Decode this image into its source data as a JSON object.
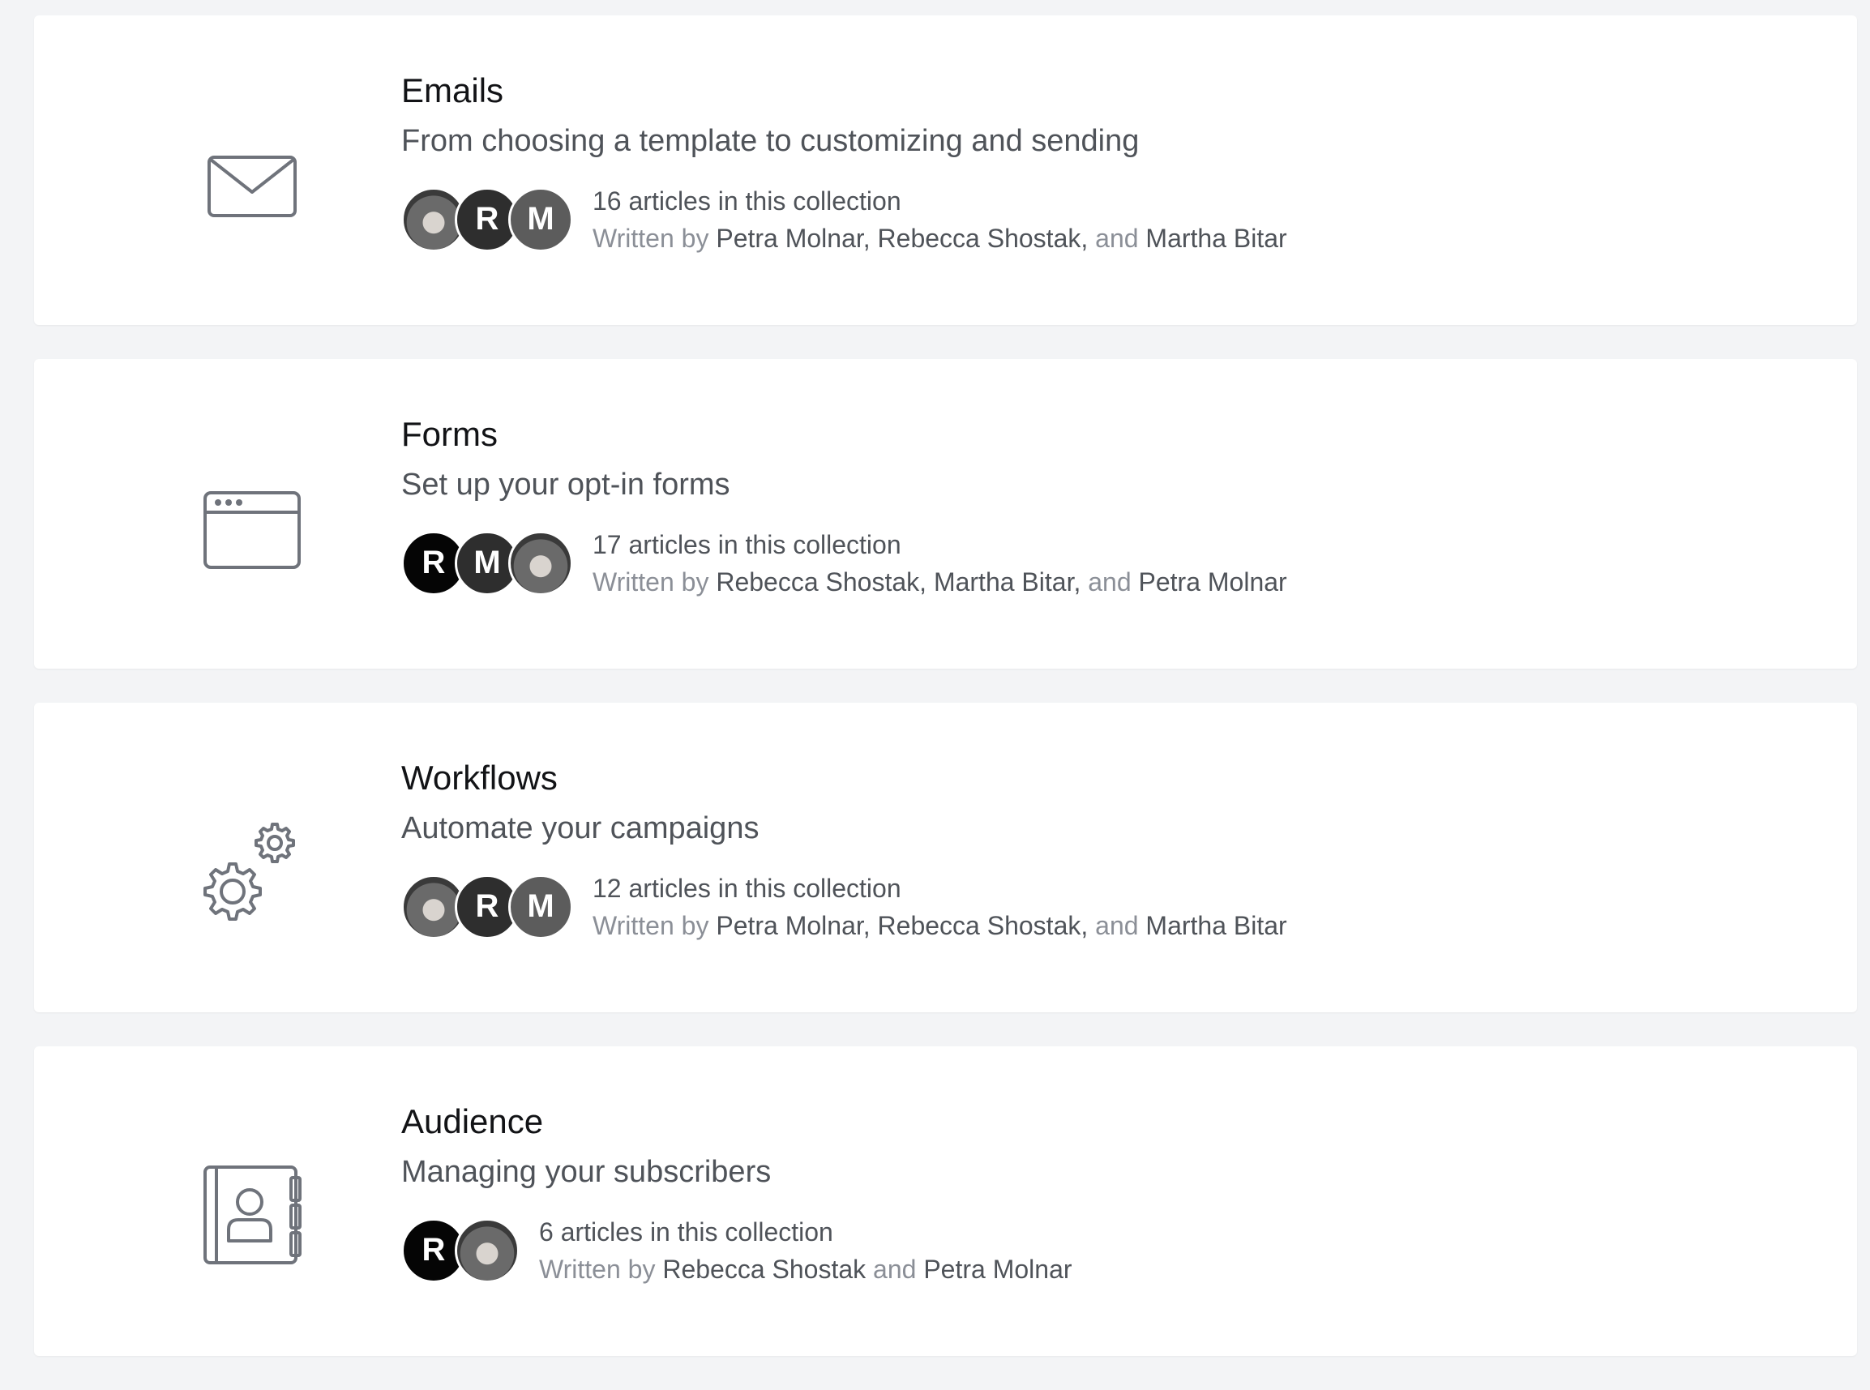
{
  "colors": {
    "page_background": "#f3f4f6",
    "card_background": "#ffffff",
    "icon_stroke": "#6f737b",
    "avatar_r_black": "#050505",
    "avatar_dark": "#2e2e2e",
    "avatar_mid": "#5c5c5c"
  },
  "collections": [
    {
      "title": "Emails",
      "description": "From choosing a template to customizing and sending",
      "icon": "envelope-icon",
      "avatars": [
        {
          "type": "photo",
          "initial": ""
        },
        {
          "type": "initial",
          "initial": "R",
          "color": "#2e2e2e"
        },
        {
          "type": "initial",
          "initial": "M",
          "color": "#5c5c5c"
        }
      ],
      "count_text": "16 articles in this collection",
      "written_by": "Written by",
      "authors": [
        "Petra Molnar",
        "Rebecca Shostak",
        "Martha Bitar"
      ],
      "sep1": ", ",
      "sep2": ", ",
      "and": "and"
    },
    {
      "title": "Forms",
      "description": "Set up your opt-in forms",
      "icon": "browser-window-icon",
      "avatars": [
        {
          "type": "initial",
          "initial": "R",
          "color": "#050505"
        },
        {
          "type": "initial",
          "initial": "M",
          "color": "#2e2e2e"
        },
        {
          "type": "photo",
          "initial": ""
        }
      ],
      "count_text": "17 articles in this collection",
      "written_by": "Written by",
      "authors": [
        "Rebecca Shostak",
        "Martha Bitar",
        "Petra Molnar"
      ],
      "sep1": ", ",
      "sep2": ", ",
      "and": "and"
    },
    {
      "title": "Workflows",
      "description": "Automate your campaigns",
      "icon": "gears-icon",
      "avatars": [
        {
          "type": "photo",
          "initial": ""
        },
        {
          "type": "initial",
          "initial": "R",
          "color": "#2e2e2e"
        },
        {
          "type": "initial",
          "initial": "M",
          "color": "#5c5c5c"
        }
      ],
      "count_text": "12 articles in this collection",
      "written_by": "Written by",
      "authors": [
        "Petra Molnar",
        "Rebecca Shostak",
        "Martha Bitar"
      ],
      "sep1": ", ",
      "sep2": ", ",
      "and": "and"
    },
    {
      "title": "Audience",
      "description": "Managing your subscribers",
      "icon": "address-book-icon",
      "avatars": [
        {
          "type": "initial",
          "initial": "R",
          "color": "#050505"
        },
        {
          "type": "photo",
          "initial": ""
        }
      ],
      "count_text": "6 articles in this collection",
      "written_by": "Written by",
      "authors": [
        "Rebecca Shostak",
        "Petra Molnar"
      ],
      "sep1": " ",
      "and": "and"
    }
  ]
}
